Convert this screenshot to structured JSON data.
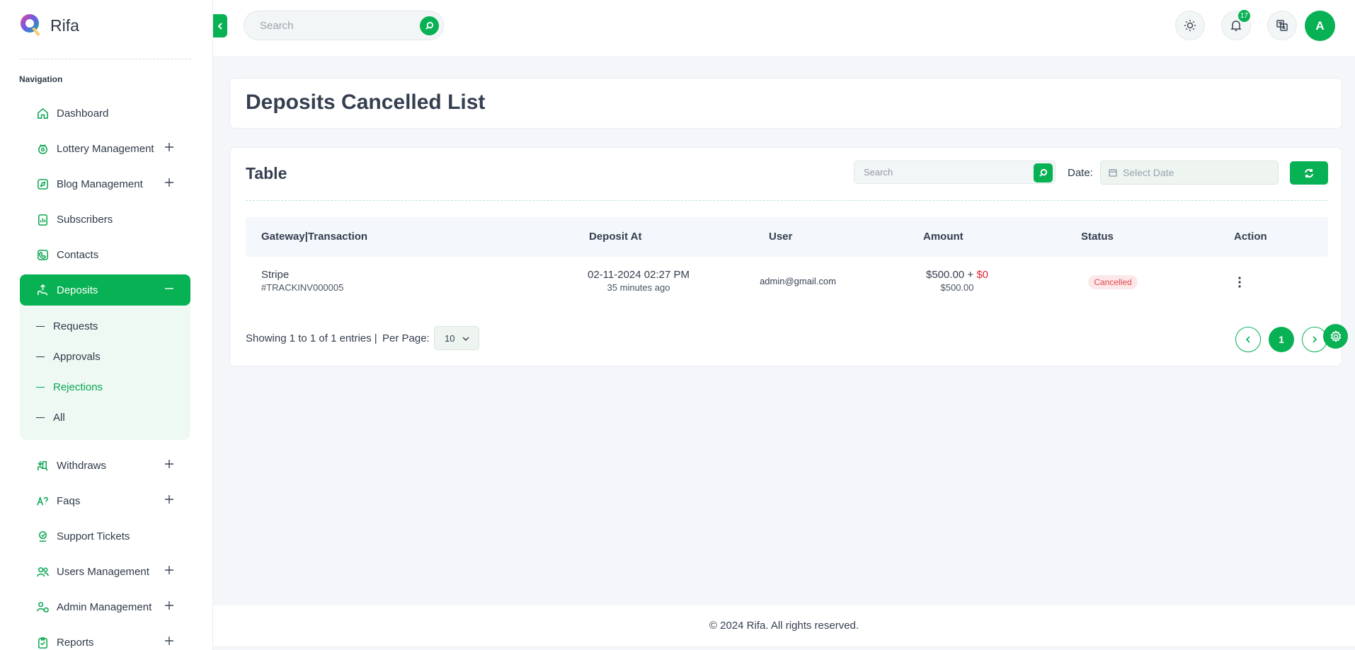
{
  "brand": {
    "name": "Rifa"
  },
  "sidebar": {
    "section_title": "Navigation",
    "items": [
      {
        "label": "Dashboard",
        "icon": "home-icon"
      },
      {
        "label": "Lottery Management",
        "icon": "lottery-icon",
        "expandable": true
      },
      {
        "label": "Blog Management",
        "icon": "blog-icon",
        "expandable": true
      },
      {
        "label": "Subscribers",
        "icon": "subscribers-icon"
      },
      {
        "label": "Contacts",
        "icon": "phone-icon"
      },
      {
        "label": "Deposits",
        "icon": "deposit-icon",
        "active": true
      }
    ],
    "deposits_sub": [
      {
        "label": "Requests"
      },
      {
        "label": "Approvals"
      },
      {
        "label": "Rejections",
        "current": true
      },
      {
        "label": "All"
      }
    ],
    "items_after": [
      {
        "label": "Withdraws",
        "icon": "withdraw-icon",
        "expandable": true
      },
      {
        "label": "Faqs",
        "icon": "faq-icon",
        "expandable": true
      },
      {
        "label": "Support Tickets",
        "icon": "support-icon"
      },
      {
        "label": "Users Management",
        "icon": "users-icon",
        "expandable": true
      },
      {
        "label": "Admin Management",
        "icon": "admin-icon",
        "expandable": true
      },
      {
        "label": "Reports",
        "icon": "reports-icon",
        "expandable": true
      }
    ]
  },
  "topbar": {
    "search_placeholder": "Search",
    "notification_count": "17",
    "avatar_initial": "A"
  },
  "page": {
    "title": "Deposits Cancelled List"
  },
  "table_card": {
    "title": "Table",
    "search_placeholder": "Search",
    "date_label": "Date:",
    "date_placeholder": "Select Date",
    "columns": [
      "Gateway|Transaction",
      "Deposit At",
      "User",
      "Amount",
      "Status",
      "Action"
    ],
    "rows": [
      {
        "gateway": "Stripe",
        "transaction": "#TRACKINV000005",
        "deposit_at": "02-11-2024 02:27 PM",
        "deposit_ago": "35 minutes ago",
        "user": "admin@gmail.com",
        "amount": "$500.00 + ",
        "fee": "$0",
        "amount_total": "$500.00",
        "status": "Cancelled"
      }
    ],
    "showing": "Showing 1 to 1 of 1 entries |",
    "per_page_label": "Per Page:",
    "per_page_value": "10",
    "current_page": "1"
  },
  "footer": {
    "text": "© 2024 Rifa. All rights reserved."
  },
  "colors": {
    "accent": "#08b153",
    "danger": "#e0242f"
  }
}
